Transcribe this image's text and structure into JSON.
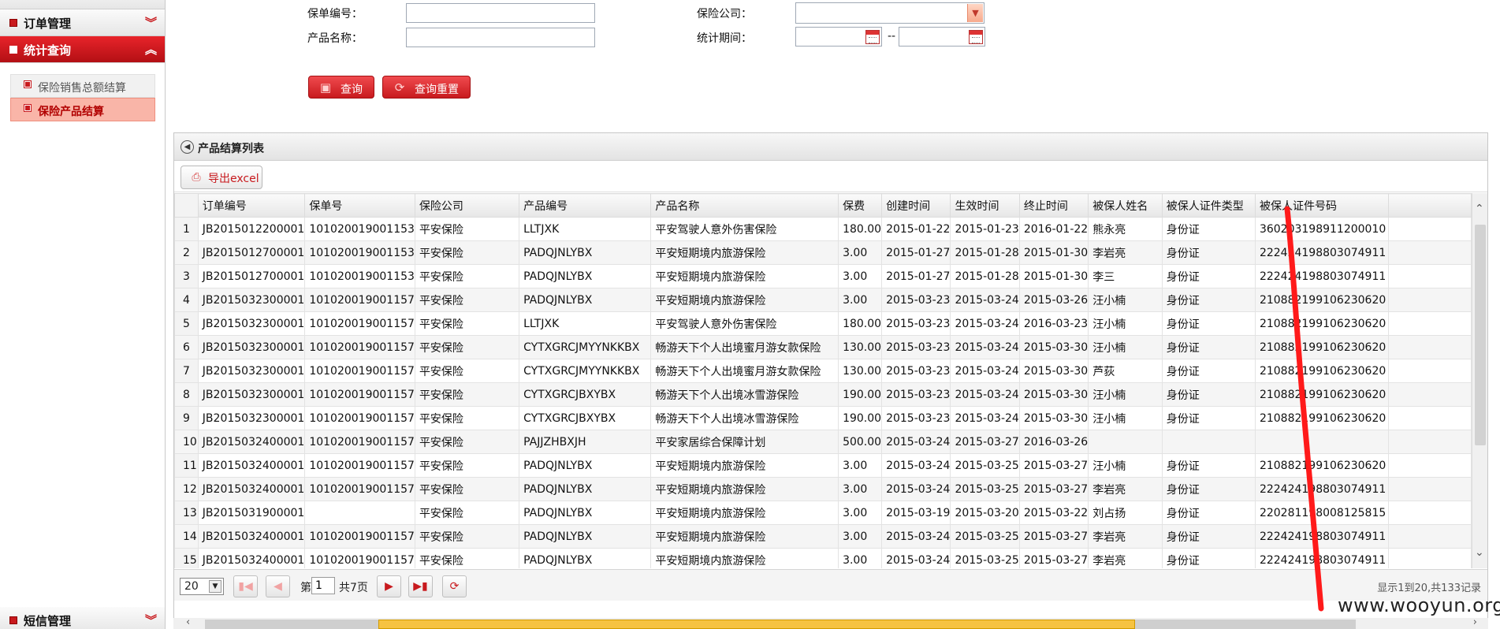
{
  "sidebar": {
    "order_mgmt": "订单管理",
    "stats_query": "统计查询",
    "sub_items": [
      "保险销售总额结算",
      "保险产品结算"
    ],
    "sms_mgmt": "短信管理"
  },
  "search": {
    "policy_no_label": "保单编号：",
    "product_name_label": "产品名称：",
    "company_label": "保险公司：",
    "period_label": "统计期间：",
    "date_sep": "--",
    "query_btn": "查询",
    "reset_btn": "查询重置"
  },
  "panel": {
    "title": "产品结算列表",
    "export_btn": "导出excel"
  },
  "table": {
    "columns": [
      "订单编号",
      "保单号",
      "保险公司",
      "产品编号",
      "产品名称",
      "保费",
      "创建时间",
      "生效时间",
      "终止时间",
      "被保人姓名",
      "被保人证件类型",
      "被保人证件号码"
    ],
    "rows": [
      [
        "1",
        "JB2015012200001",
        "101020019001153",
        "平安保险",
        "LLTJXK",
        "平安驾驶人意外伤害保险",
        "180.00",
        "2015-01-22",
        "2015-01-23",
        "2016-01-22",
        "熊永亮",
        "身份证",
        "360203198911200010"
      ],
      [
        "2",
        "JB2015012700001",
        "101020019001153",
        "平安保险",
        "PADQJNLYBX",
        "平安短期境内旅游保险",
        "3.00",
        "2015-01-27",
        "2015-01-28",
        "2015-01-30",
        "李岩亮",
        "身份证",
        "222424198803074911"
      ],
      [
        "3",
        "JB2015012700001",
        "101020019001153",
        "平安保险",
        "PADQJNLYBX",
        "平安短期境内旅游保险",
        "3.00",
        "2015-01-27",
        "2015-01-28",
        "2015-01-30",
        "李三",
        "身份证",
        "222424198803074911"
      ],
      [
        "4",
        "JB2015032300001",
        "101020019001157",
        "平安保险",
        "PADQJNLYBX",
        "平安短期境内旅游保险",
        "3.00",
        "2015-03-23",
        "2015-03-24",
        "2015-03-26",
        "汪小楠",
        "身份证",
        "210882199106230620"
      ],
      [
        "5",
        "JB2015032300001",
        "101020019001157",
        "平安保险",
        "LLTJXK",
        "平安驾驶人意外伤害保险",
        "180.00",
        "2015-03-23",
        "2015-03-24",
        "2016-03-23",
        "汪小楠",
        "身份证",
        "210882199106230620"
      ],
      [
        "6",
        "JB2015032300001",
        "101020019001157",
        "平安保险",
        "CYTXGRCJMYYNKKBX",
        "畅游天下个人出境蜜月游女款保险",
        "130.00",
        "2015-03-23",
        "2015-03-24",
        "2015-03-30",
        "汪小楠",
        "身份证",
        "210882199106230620"
      ],
      [
        "7",
        "JB2015032300001",
        "101020019001157",
        "平安保险",
        "CYTXGRCJMYYNKKBX",
        "畅游天下个人出境蜜月游女款保险",
        "130.00",
        "2015-03-23",
        "2015-03-24",
        "2015-03-30",
        "芦荻",
        "身份证",
        "210882199106230620"
      ],
      [
        "8",
        "JB2015032300001",
        "101020019001157",
        "平安保险",
        "CYTXGRCJBXYBX",
        "畅游天下个人出境冰雪游保险",
        "190.00",
        "2015-03-23",
        "2015-03-24",
        "2015-03-30",
        "汪小楠",
        "身份证",
        "210882199106230620"
      ],
      [
        "9",
        "JB2015032300001",
        "101020019001157",
        "平安保险",
        "CYTXGRCJBXYBX",
        "畅游天下个人出境冰雪游保险",
        "190.00",
        "2015-03-23",
        "2015-03-24",
        "2015-03-30",
        "汪小楠",
        "身份证",
        "210882199106230620"
      ],
      [
        "10",
        "JB2015032400001",
        "101020019001157",
        "平安保险",
        "PAJJZHBXJH",
        "平安家居综合保障计划",
        "500.00",
        "2015-03-24",
        "2015-03-27",
        "2016-03-26",
        "",
        "",
        ""
      ],
      [
        "11",
        "JB2015032400001",
        "101020019001157",
        "平安保险",
        "PADQJNLYBX",
        "平安短期境内旅游保险",
        "3.00",
        "2015-03-24",
        "2015-03-25",
        "2015-03-27",
        "汪小楠",
        "身份证",
        "210882199106230620"
      ],
      [
        "12",
        "JB2015032400001",
        "101020019001157",
        "平安保险",
        "PADQJNLYBX",
        "平安短期境内旅游保险",
        "3.00",
        "2015-03-24",
        "2015-03-25",
        "2015-03-27",
        "李岩亮",
        "身份证",
        "222424198803074911"
      ],
      [
        "13",
        "JB2015031900001",
        "",
        "平安保险",
        "PADQJNLYBX",
        "平安短期境内旅游保险",
        "3.00",
        "2015-03-19",
        "2015-03-20",
        "2015-03-22",
        "刘占扬",
        "身份证",
        "220281198008125815"
      ],
      [
        "14",
        "JB2015032400001",
        "101020019001157",
        "平安保险",
        "PADQJNLYBX",
        "平安短期境内旅游保险",
        "3.00",
        "2015-03-24",
        "2015-03-25",
        "2015-03-27",
        "李岩亮",
        "身份证",
        "222424198803074911"
      ],
      [
        "15",
        "JB2015032400001",
        "101020019001157",
        "平安保险",
        "PADQJNLYBX",
        "平安短期境内旅游保险",
        "3.00",
        "2015-03-24",
        "2015-03-25",
        "2015-03-27",
        "李岩亮",
        "身份证",
        "222424198803074911"
      ]
    ]
  },
  "pager": {
    "page_size": "20",
    "page_prefix": "第",
    "page_num": "1",
    "page_total": "共7页",
    "info": "显示1到20,共133记录"
  },
  "watermark": "www.wooyun.org",
  "colors": {
    "accent": "#c81a1e",
    "highlight": "#f9b5a8",
    "annotation": "#ff1a1a"
  }
}
